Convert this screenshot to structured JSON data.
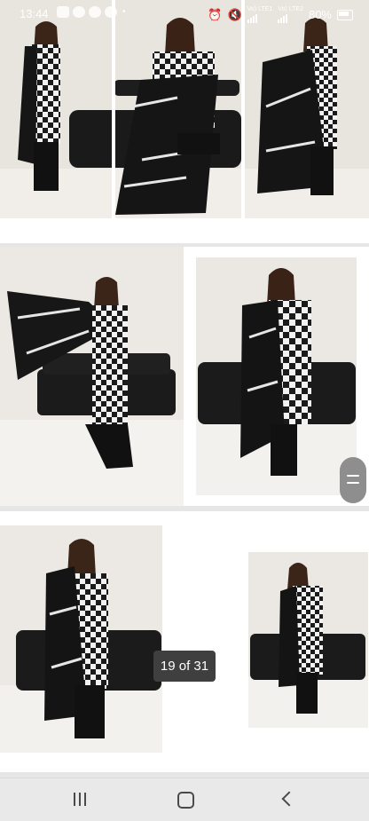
{
  "status_bar": {
    "time": "13:44",
    "battery": "80%",
    "network_label_1": "Vo) LTE1",
    "network_label_2": "Vo) LTE2"
  },
  "gallery": {
    "counter": "19 of 31"
  },
  "colors": {
    "pill_bg": "#3f3f3f",
    "page_bg": "#e6e6e6",
    "nav_bg": "#e9e9ea"
  },
  "icons": [
    "gallery-icon",
    "message-icon",
    "whatsapp-icon",
    "app-icon",
    "alarm-icon",
    "mute-icon",
    "signal-icon",
    "battery-icon",
    "recents-icon",
    "home-icon",
    "back-icon",
    "scroll-handle-icon"
  ]
}
